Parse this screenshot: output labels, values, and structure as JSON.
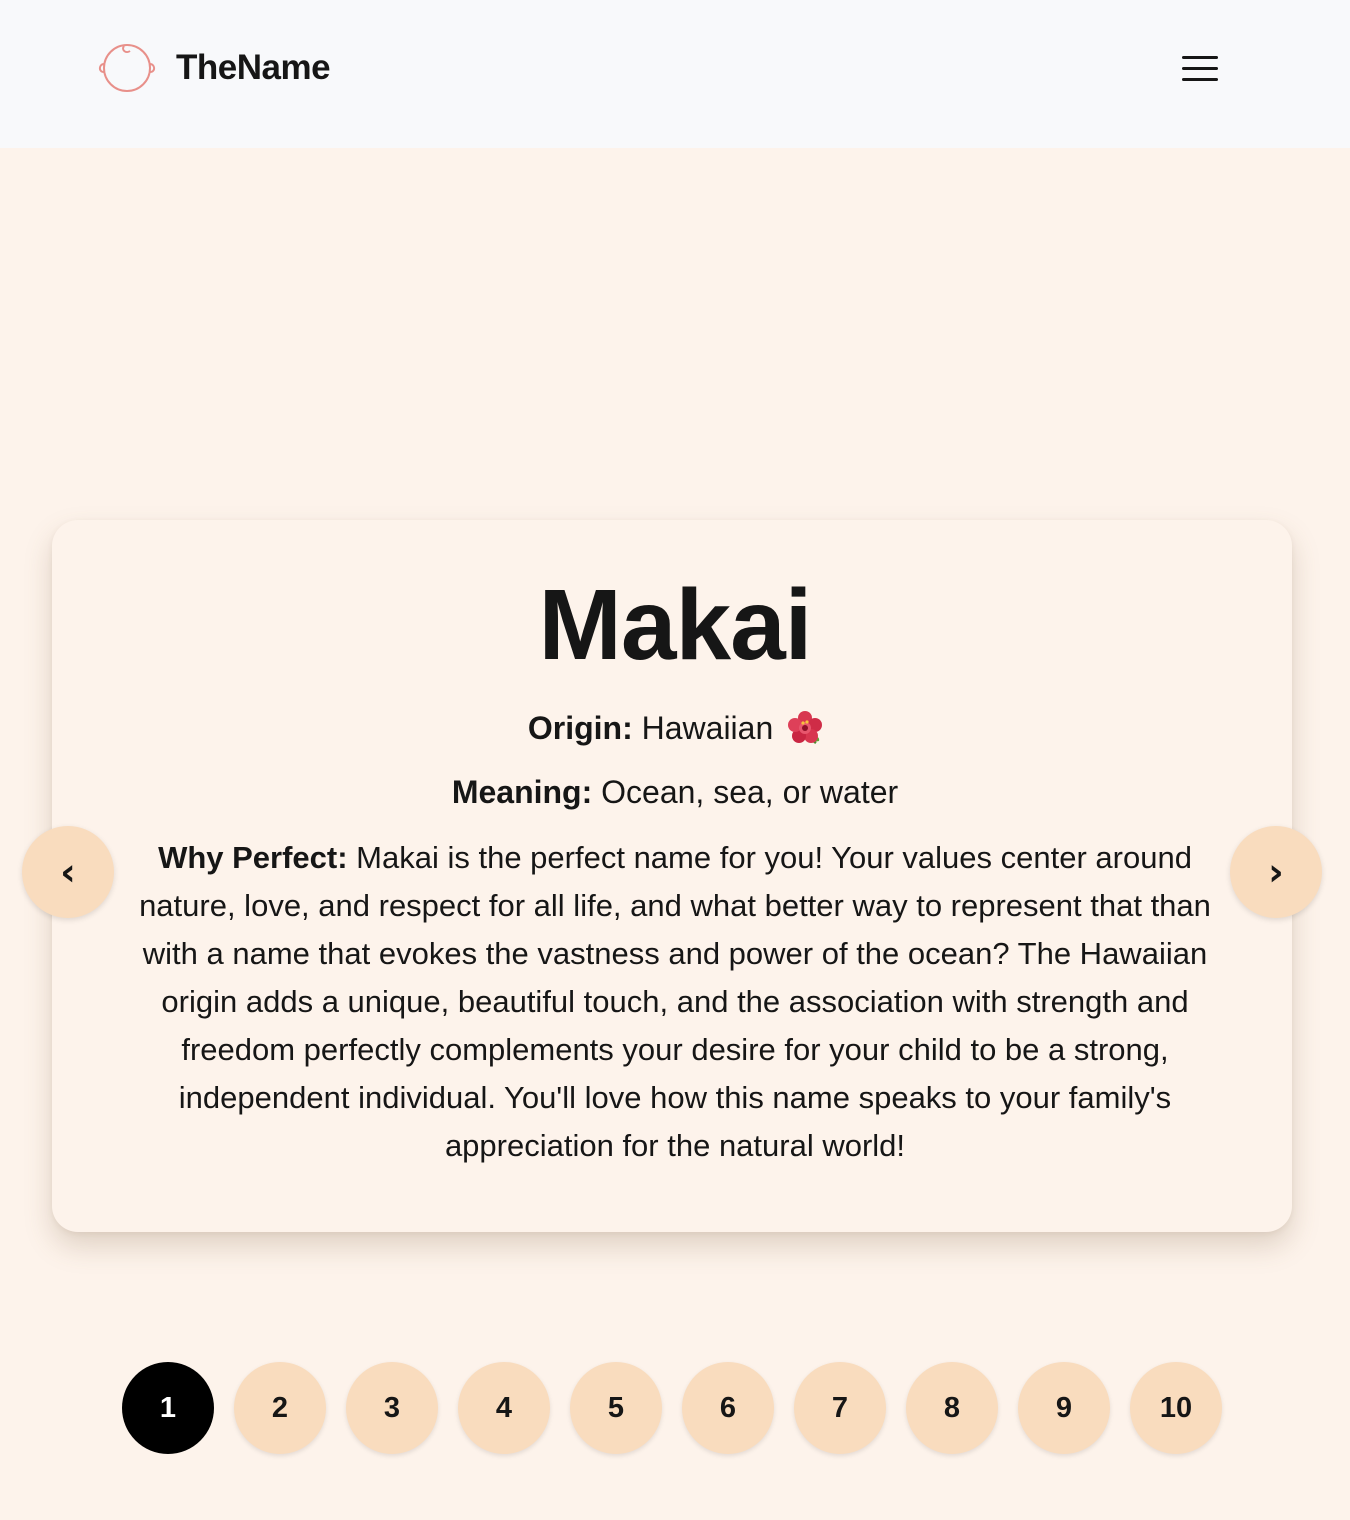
{
  "header": {
    "brand_name": "TheName",
    "logo_icon": "baby-face-icon",
    "menu_icon": "hamburger-menu-icon"
  },
  "card": {
    "name": "Makai",
    "origin_label": "Origin:",
    "origin_value": "Hawaiian",
    "origin_emoji": "hibiscus-icon",
    "meaning_label": "Meaning:",
    "meaning_value": "Ocean, sea, or water",
    "why_label": "Why Perfect:",
    "why_text": "Makai is the perfect name for you! Your values center around nature, love, and respect for all life, and what better way to represent that than with a name that evokes the vastness and power of the ocean? The Hawaiian origin adds a unique, beautiful touch, and the association with strength and freedom perfectly complements your desire for your child to be a strong, independent individual. You'll love how this name speaks to your family's appreciation for the natural world!"
  },
  "carousel": {
    "prev_label": "‹",
    "next_label": "›",
    "pages": [
      "1",
      "2",
      "3",
      "4",
      "5",
      "6",
      "7",
      "8",
      "9",
      "10"
    ],
    "active_page": 1
  },
  "colors": {
    "page_background": "#fdf3eb",
    "header_background": "#f8f9fb",
    "button_peach": "#f9dcbe",
    "active_dot": "#000000",
    "logo_stroke": "#e8908a"
  }
}
